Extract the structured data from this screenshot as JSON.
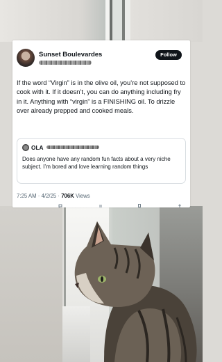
{
  "post": {
    "author_name": "Sunset Boulevardes",
    "follow_label": "Follow",
    "body": "If the word “Virgin” is in the olive oil, you’re not supposed to cook with it. If it doesn’t, you can do anything including fry in it. Anything with “virgin” is a FINISHING oil. To drizzle over already prepped and cooked meals.",
    "quoted": {
      "author_name": "OLA",
      "text": "Does anyone have any random fun facts about a very niche subject. I’m bored and love learning random things"
    },
    "time": "7:25 AM",
    "separator": "·",
    "date": "4/2/25",
    "views_count": "706K",
    "views_label": "Views"
  },
  "icons": {
    "reply": "reply-icon",
    "repost": "repost-icon",
    "like": "like-icon",
    "bookmark": "bookmark-icon",
    "share": "share-icon"
  },
  "colors": {
    "text": "#0f1419",
    "secondary": "#536471",
    "follow_bg": "#0f1419",
    "card_bg": "#ffffff",
    "border": "#d8dde1"
  }
}
